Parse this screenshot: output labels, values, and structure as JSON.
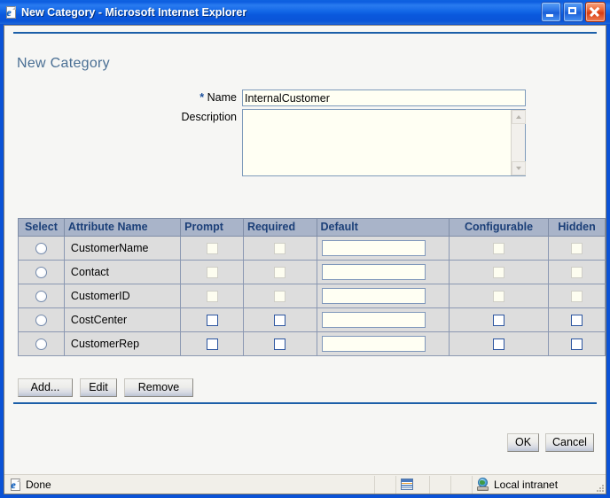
{
  "window": {
    "title": "New Category - Microsoft Internet Explorer",
    "icon": "ie-page-icon",
    "minimize_label": "Minimize",
    "restore_label": "Restore",
    "close_label": "Close"
  },
  "page": {
    "heading": "New Category",
    "fields": {
      "name": {
        "label": "Name",
        "required_marker": "*",
        "value": "InternalCustomer",
        "placeholder": ""
      },
      "description": {
        "label": "Description",
        "value": "",
        "placeholder": ""
      }
    },
    "grid": {
      "columns": [
        "Select",
        "Attribute Name",
        "Prompt",
        "Required",
        "Default",
        "Configurable",
        "Hidden"
      ],
      "rows": [
        {
          "selected": false,
          "attribute_name": "CustomerName",
          "prompt": false,
          "required": false,
          "default": "",
          "configurable": false,
          "hidden": false,
          "enabled": false
        },
        {
          "selected": false,
          "attribute_name": "Contact",
          "prompt": false,
          "required": false,
          "default": "",
          "configurable": false,
          "hidden": false,
          "enabled": false
        },
        {
          "selected": false,
          "attribute_name": "CustomerID",
          "prompt": false,
          "required": false,
          "default": "",
          "configurable": false,
          "hidden": false,
          "enabled": false
        },
        {
          "selected": false,
          "attribute_name": "CostCenter",
          "prompt": false,
          "required": false,
          "default": "",
          "configurable": false,
          "hidden": false,
          "enabled": true
        },
        {
          "selected": false,
          "attribute_name": "CustomerRep",
          "prompt": false,
          "required": false,
          "default": "",
          "configurable": false,
          "hidden": false,
          "enabled": true
        }
      ]
    },
    "toolbar": {
      "add_label": "Add...",
      "edit_label": "Edit",
      "remove_label": "Remove"
    },
    "dialog_buttons": {
      "ok_label": "OK",
      "cancel_label": "Cancel"
    }
  },
  "statusbar": {
    "message": "Done",
    "zone_label": "Local intranet",
    "zone_icon": "globe-icon",
    "doc_icon": "document-icon"
  },
  "colors": {
    "titlebar_blue": "#0a58dd",
    "heading_blue": "#4a6f94",
    "rule_blue": "#1c5fa8",
    "grid_header_bg": "#a9b4c9",
    "grid_header_text": "#1b3f78",
    "grid_row_bg": "#dddddd",
    "input_bg": "#fffff3",
    "input_border": "#7e9bbb",
    "close_button_red": "#d83c12"
  }
}
